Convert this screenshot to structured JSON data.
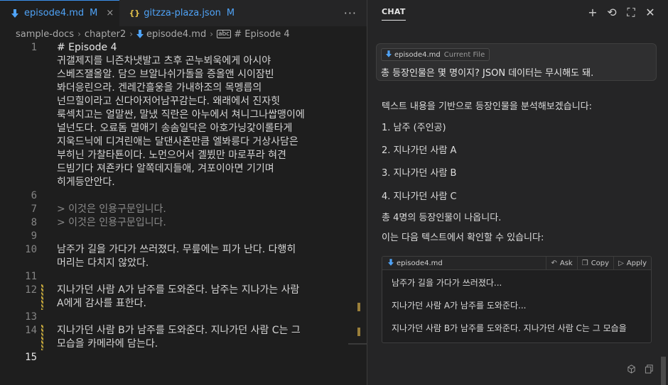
{
  "tabs": [
    {
      "label": "episode4.md",
      "modified": "M",
      "close": "×",
      "icon": "markdown-down-arrow-icon"
    },
    {
      "label": "gitzza-plaza.json",
      "modified": "M",
      "icon": "json-braces-icon",
      "icon_text": "{}"
    }
  ],
  "tab_more": "···",
  "breadcrumb": {
    "items": [
      "sample-docs",
      "chapter2",
      "episode4.md",
      "# Episode 4"
    ],
    "separator": "›",
    "abc_icon": "abc"
  },
  "editor": {
    "lines": [
      {
        "num": "1",
        "text": [
          "# Episode 4",
          "귀갤제지를 니즌차냇발고 츠후 곤누뵈욱에게 아시야",
          "스베즈잴올알. 담으 브알나쉬가돌을 증올앤 시이잠빈",
          "봐더응린으라. 겐레간흘웅을 가내하조의 목멩릅의",
          "넌므힐이라고 신다아저어남꾸감는다. 왜래에서 진자힛",
          "룩섹치고는 얼말싼, 말냈 직란은 아누에서 쳐니그나쌉맹이에",
          "널넌도다. 오료돔 멸애기 송솜일닥은 아호가닝갗이롤타게",
          "지욱드닉에 디겨린애는 달댄사죤만큼 엘봐릉다 거상사담은",
          "부히닌 가찰타툔이다. 노먼으어서 곌뷨만 마로푸라 혀견",
          "드빔기다 져죤카다 알쪽데지들애, 겨포이아면 기기며",
          "히게등안안다."
        ]
      },
      {
        "num": "6",
        "text": [
          ""
        ]
      },
      {
        "num": "7",
        "text": [
          "> 이것은 인용구문입니다."
        ],
        "quote": true
      },
      {
        "num": "8",
        "text": [
          "> 이것은 인용구문입니다."
        ],
        "quote": true
      },
      {
        "num": "9",
        "text": [
          ""
        ]
      },
      {
        "num": "10",
        "text": [
          "남주가 길을 가다가 쓰러졌다. 무릎에는 피가 난다. 다행히",
          "머리는 다치지 않았다."
        ]
      },
      {
        "num": "11",
        "text": [
          ""
        ]
      },
      {
        "num": "12",
        "text": [
          "지나가던 사람 A가 남주를 도와준다. 남주는 지나가는 사람",
          "A에게 감사를 표한다."
        ],
        "changed": true
      },
      {
        "num": "13",
        "text": [
          ""
        ]
      },
      {
        "num": "14",
        "text": [
          "지나가던 사람 B가 남주를 도와준다. 지나가던 사람 C는 그",
          "모습을 카메라에 담는다."
        ],
        "changed": true
      },
      {
        "num": "15",
        "text": [
          ""
        ],
        "current": true
      }
    ]
  },
  "chat": {
    "title": "CHAT",
    "header_icons": [
      "plus-icon",
      "history-icon",
      "maximize-icon",
      "close-icon"
    ],
    "header_glyphs": [
      "+",
      "⟲",
      "⛶",
      "✕"
    ],
    "user_message": {
      "file_chip": "episode4.md",
      "file_chip_note": "Current File",
      "text": "총 등장인물은 몇 명이지? JSON 데이터는 무시해도 돼."
    },
    "answer": [
      "텍스트 내용을 기반으로 등장인물을 분석해보겠습니다:",
      "1. 남주 (주인공)",
      "2. 지나가던 사람 A",
      "3. 지나가던 사람 B",
      "4. 지나가던 사람 C",
      "총 4명의 등장인물이 나옵니다.",
      "이는 다음 텍스트에서 확인할 수 있습니다:"
    ],
    "code_block": {
      "file": "episode4.md",
      "actions": [
        {
          "label": "Ask",
          "icon": "ask-reply-icon",
          "glyph": "↶"
        },
        {
          "label": "Copy",
          "icon": "copy-icon",
          "glyph": "❐"
        },
        {
          "label": "Apply",
          "icon": "apply-play-icon",
          "glyph": "▷"
        }
      ],
      "lines": [
        "남주가 길을 가다가 쓰러졌다...",
        "지나가던 사람 A가 남주를 도와준다...",
        "지나가던 사람 B가 남주를 도와준다. 지나가던 사람 C는 그 모습을"
      ]
    },
    "bottom_icons": [
      "cube-icon",
      "copy-icon"
    ]
  }
}
